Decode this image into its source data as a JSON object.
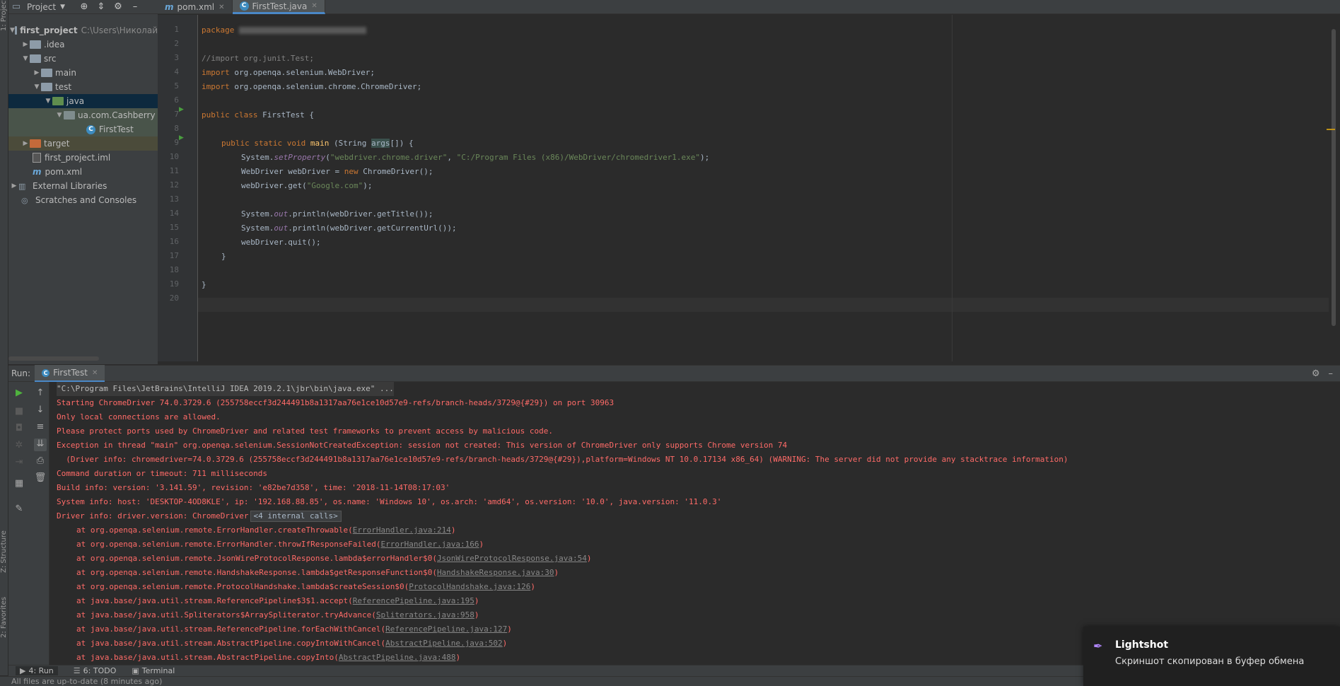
{
  "project_panel": {
    "title": "Project",
    "tree": [
      {
        "label": "first_project",
        "hint": "C:\\Users\\Николай"
      },
      {
        "label": ".idea"
      },
      {
        "label": "src"
      },
      {
        "label": "main"
      },
      {
        "label": "test"
      },
      {
        "label": "java"
      },
      {
        "label": "ua.com.Cashberry"
      },
      {
        "label": "FirstTest"
      },
      {
        "label": "target"
      },
      {
        "label": "first_project.iml"
      },
      {
        "label": "pom.xml"
      },
      {
        "label": "External Libraries"
      },
      {
        "label": "Scratches and Consoles"
      }
    ]
  },
  "side_tabs": {
    "project": "1: Project",
    "structure": "Z: Structure",
    "favorites": "2: Favorites"
  },
  "editor_tabs": [
    {
      "label": "pom.xml",
      "icon": "m"
    },
    {
      "label": "FirstTest.java",
      "icon": "C"
    }
  ],
  "code": {
    "line_numbers": [
      "1",
      "2",
      "3",
      "4",
      "5",
      "6",
      "7",
      "8",
      "9",
      "10",
      "11",
      "12",
      "13",
      "14",
      "15",
      "16",
      "17",
      "18",
      "19",
      "20"
    ],
    "package_kw": "package",
    "l3": "//import org.junit.Test;",
    "l4_kw": "import",
    "l4_rest": " org.openqa.selenium.WebDriver;",
    "l5_kw": "import",
    "l5_rest": " org.openqa.selenium.chrome.ChromeDriver;",
    "l7_kw": "public class",
    "l7_rest": " FirstTest {",
    "l9_kw": "public static void",
    "l9_fn": "main",
    "l9_a": " (String ",
    "l9_arg": "args",
    "l9_b": "[]) {",
    "l10_a": "System.",
    "l10_m": "setProperty",
    "l10_b": "(",
    "l10_s1": "\"webdriver.chrome.driver\"",
    "l10_c": ", ",
    "l10_s2": "\"C:/Program Files (x86)/WebDriver/chromedriver1.exe\"",
    "l10_d": ");",
    "l11_a": "WebDriver webDriver = ",
    "l11_kw": "new",
    "l11_b": " ChromeDriver();",
    "l12_a": "webDriver.get(",
    "l12_s": "\"Google.com\"",
    "l12_b": ");",
    "l14_a": "System.",
    "l14_o": "out",
    "l14_b": ".println(webDriver.getTitle());",
    "l15_a": "System.",
    "l15_o": "out",
    "l15_b": ".println(webDriver.getCurrentUrl());",
    "l16": "webDriver.quit();",
    "l17": "}",
    "l19": "}"
  },
  "run_panel": {
    "label": "Run:",
    "tab": "FirstTest",
    "console": [
      "\"C:\\Program Files\\JetBrains\\IntelliJ IDEA 2019.2.1\\jbr\\bin\\java.exe\" ...",
      "Starting ChromeDriver 74.0.3729.6 (255758eccf3d244491b8a1317aa76e1ce10d57e9-refs/branch-heads/3729@{#29}) on port 30963",
      "Only local connections are allowed.",
      "Please protect ports used by ChromeDriver and related test frameworks to prevent access by malicious code.",
      "Exception in thread \"main\" org.openqa.selenium.SessionNotCreatedException: session not created: This version of ChromeDriver only supports Chrome version 74",
      "  (Driver info: chromedriver=74.0.3729.6 (255758eccf3d244491b8a1317aa76e1ce10d57e9-refs/branch-heads/3729@{#29}),platform=Windows NT 10.0.17134 x86_64) (WARNING: The server did not provide any stacktrace information)",
      "Command duration or timeout: 711 milliseconds",
      "Build info: version: '3.141.59', revision: 'e82be7d358', time: '2018-11-14T08:17:03'",
      "System info: host: 'DESKTOP-4OD8KLE', ip: '192.168.88.85', os.name: 'Windows 10', os.arch: 'amd64', os.version: '10.0', java.version: '11.0.3'",
      "Driver info: driver.version: ChromeDriver"
    ],
    "fold_label": "<4 internal calls>",
    "stack": [
      {
        "text": "at org.openqa.selenium.remote.ErrorHandler.createThrowable(",
        "link": "ErrorHandler.java:214",
        "end": ")"
      },
      {
        "text": "at org.openqa.selenium.remote.ErrorHandler.throwIfResponseFailed(",
        "link": "ErrorHandler.java:166",
        "end": ")"
      },
      {
        "text": "at org.openqa.selenium.remote.JsonWireProtocolResponse.lambda$errorHandler$0(",
        "link": "JsonWireProtocolResponse.java:54",
        "end": ")"
      },
      {
        "text": "at org.openqa.selenium.remote.HandshakeResponse.lambda$getResponseFunction$0(",
        "link": "HandshakeResponse.java:30",
        "end": ")"
      },
      {
        "text": "at org.openqa.selenium.remote.ProtocolHandshake.lambda$createSession$0(",
        "link": "ProtocolHandshake.java:126",
        "end": ")"
      },
      {
        "text": "at java.base/java.util.stream.ReferencePipeline$3$1.accept(",
        "link": "ReferencePipeline.java:195",
        "end": ")"
      },
      {
        "text": "at java.base/java.util.Spliterators$ArraySpliterator.tryAdvance(",
        "link": "Spliterators.java:958",
        "end": ")"
      },
      {
        "text": "at java.base/java.util.stream.ReferencePipeline.forEachWithCancel(",
        "link": "ReferencePipeline.java:127",
        "end": ")"
      },
      {
        "text": "at java.base/java.util.stream.AbstractPipeline.copyIntoWithCancel(",
        "link": "AbstractPipeline.java:502",
        "end": ")"
      },
      {
        "text": "at java.base/java.util.stream.AbstractPipeline.copyInto(",
        "link": "AbstractPipeline.java:488",
        "end": ")"
      }
    ]
  },
  "bottom_tabs": {
    "run": "4: Run",
    "todo": "6: TODO",
    "terminal": "Terminal"
  },
  "status": "All files are up-to-date (8 minutes ago)",
  "notification": {
    "title": "Lightshot",
    "message": "Скриншот скопирован в буфер обмена"
  },
  "colors": {
    "accent": "#4a88c7",
    "error_text": "#ff6b68",
    "keyword": "#cc7832",
    "string": "#6a8759"
  }
}
